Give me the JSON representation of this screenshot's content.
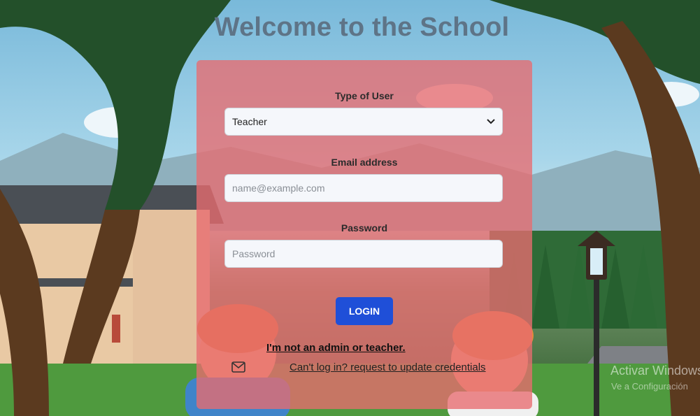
{
  "page": {
    "title": "Welcome to the School"
  },
  "form": {
    "user_type_label": "Type of User",
    "user_type_value": "Teacher",
    "email_label": "Email address",
    "email_placeholder": "name@example.com",
    "password_label": "Password",
    "password_placeholder": "Password",
    "login_label": "LOGIN",
    "guest_link": "I'm not an admin or teacher.",
    "credentials_link": "Can't log in? request to update credentials"
  },
  "watermark": {
    "line1": "Activar Windows",
    "line2": "Ve a Configuración"
  },
  "icons": {
    "mail": "mail-icon",
    "chevron": "chevron-down-icon"
  },
  "colors": {
    "card": "#e86c70",
    "button": "#1f4fd8",
    "title": "#5e7487"
  }
}
